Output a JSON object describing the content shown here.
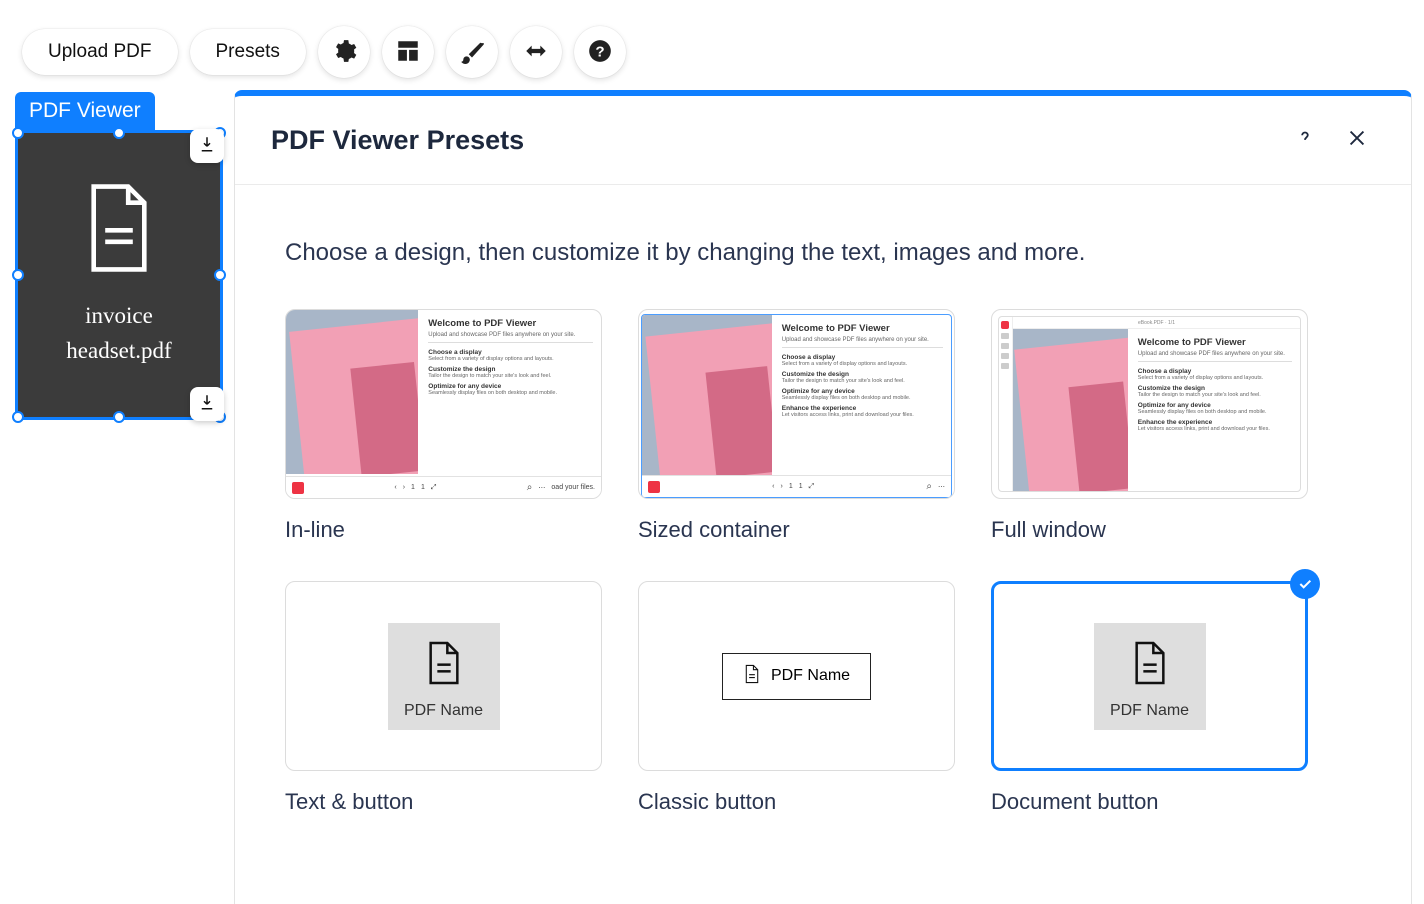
{
  "toolbar": {
    "upload_label": "Upload PDF",
    "presets_label": "Presets"
  },
  "widget": {
    "label": "PDF Viewer",
    "filename_line1": "invoice",
    "filename_line2": "headset.pdf"
  },
  "panel": {
    "title": "PDF Viewer Presets",
    "subtitle": "Choose a design, then customize it by changing the text, images and more."
  },
  "thumb_text": {
    "title": "Welcome to PDF Viewer",
    "subtitle": "Upload and showcase PDF files anywhere on your site.",
    "h1": "Choose a display",
    "p1": "Select from a variety of display options and layouts.",
    "h2": "Customize the design",
    "p2": "Tailor the design to match your site's look and feel.",
    "h3": "Optimize for any device",
    "p3": "Seamlessly display files on both desktop and mobile.",
    "h4": "Enhance the experience",
    "p4": "Let visitors access links, print and download your files.",
    "page_a": "1",
    "page_b": "1",
    "tool_text": "oad your files."
  },
  "presets": {
    "inline": "In-line",
    "sized": "Sized container",
    "full": "Full window",
    "textbtn": "Text & button",
    "classic": "Classic button",
    "docbtn": "Document button",
    "pdfname": "PDF Name"
  }
}
